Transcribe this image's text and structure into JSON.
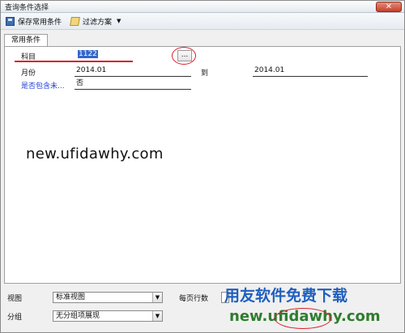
{
  "window": {
    "title": "查询条件选择",
    "close_glyph": "✕"
  },
  "toolbar": {
    "save_label": "保存常用条件",
    "filter_label": "过滤方案",
    "dropdown_glyph": "▼"
  },
  "tabs": [
    {
      "label": "常用条件"
    }
  ],
  "form": {
    "subject_label": "科目",
    "subject_value": "1122",
    "browse_glyph": "...",
    "month_label": "月份",
    "month_from": "2014.01",
    "to_label": "到",
    "month_to": "2014.01",
    "include_unposted_label": "是否包含未...",
    "include_unposted_value": "否"
  },
  "watermark_center": "new.ufidawhy.com",
  "bottom": {
    "view_label": "视图",
    "view_value": "标准视图",
    "rows_per_page_label": "每页行数",
    "group_label": "分组",
    "group_value": "无分组项展现"
  },
  "brand_watermark": {
    "cn_text": "用友软件免费下载",
    "url_text": "new.ufidawhy.com"
  },
  "colors": {
    "accent_red": "#d4202a",
    "link_blue": "#1f3fd6",
    "selection": "#3366cc",
    "brand_cn": "#1f5fbf",
    "brand_url": "#2e7d2e"
  }
}
